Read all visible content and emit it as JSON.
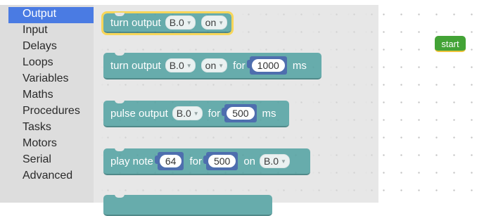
{
  "toolbox": {
    "categories": [
      "Output",
      "Input",
      "Delays",
      "Loops",
      "Variables",
      "Maths",
      "Procedures",
      "Tasks",
      "Motors",
      "Serial",
      "Advanced"
    ],
    "selected": "Output"
  },
  "blocks": {
    "turn_output": {
      "label": "turn output",
      "pin": "B.0",
      "state": "on"
    },
    "turn_output_for": {
      "label": "turn output",
      "pin": "B.0",
      "state": "on",
      "for_label": "for",
      "duration": "1000",
      "unit": "ms"
    },
    "pulse_output": {
      "label": "pulse output",
      "pin": "B.0",
      "for_label": "for",
      "duration": "500",
      "unit": "ms"
    },
    "play_note": {
      "label": "play note",
      "note": "64",
      "for_label": "for",
      "duration": "500",
      "on_label": "on",
      "pin": "B.0"
    }
  },
  "workspace": {
    "start_label": "start"
  },
  "colors": {
    "block": "#5ba5a5",
    "number_socket": "#3f62a8",
    "start": "#43a336",
    "selected_category": "#4a7be3",
    "highlight": "#f7d34b"
  }
}
